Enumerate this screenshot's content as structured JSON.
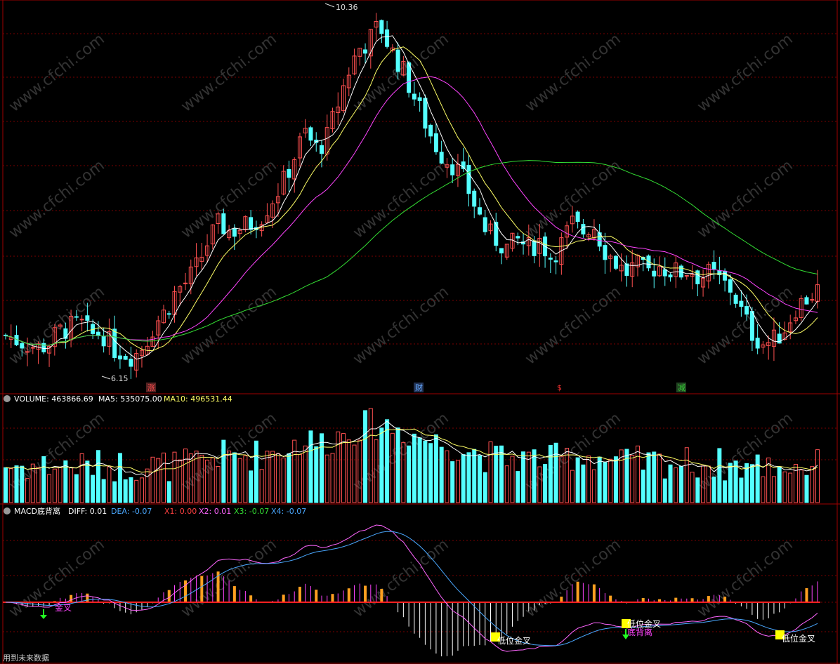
{
  "main_panel": {
    "high_label": "10.36",
    "low_label": "6.15",
    "markers": [
      {
        "text": "涨",
        "color": "#ff4d4d",
        "bg": "#552222"
      },
      {
        "text": "财",
        "color": "#66aaff",
        "bg": "#223355"
      },
      {
        "text": "$",
        "color": "#ff3333",
        "bg": ""
      },
      {
        "text": "减",
        "color": "#33cc33",
        "bg": "#224422"
      }
    ]
  },
  "volume_panel": {
    "title": "VOLUME: 463866.69",
    "ma5": "MA5: 535075.00",
    "ma10": "MA10: 496531.44"
  },
  "macd_panel": {
    "title": "MACD底背离",
    "diff": "DIFF: 0.01",
    "dea": "DEA: -0.07",
    "x1": "X1: 0.00",
    "x2": "X2: 0.01",
    "x3": "X3: -0.07",
    "x4": "X4: -0.07",
    "signals": [
      {
        "text": "金叉"
      },
      {
        "text": "低位金叉"
      },
      {
        "text": "低位金叉"
      },
      {
        "text": "底背离"
      },
      {
        "text": "低位金叉"
      }
    ]
  },
  "footer": {
    "note": "用到未来数据"
  },
  "watermark": "www.cfchi.com",
  "colors": {
    "up": "#ff5050",
    "down": "#54ffff",
    "ma5": "#ffffff",
    "ma10": "#ffff66",
    "ma20": "#ff44ff",
    "ma60": "#33dd33",
    "grid": "#7a0000",
    "macd_pos": "#ffa020",
    "macd_neg": "#ffffff"
  },
  "chart_data": {
    "type": "candlestick",
    "price_range": [
      6.15,
      10.36
    ],
    "close_path": [
      6.45,
      6.4,
      6.35,
      6.3,
      6.35,
      6.5,
      6.55,
      6.6,
      6.45,
      6.5,
      6.3,
      6.25,
      6.2,
      6.35,
      6.6,
      6.75,
      7.0,
      7.1,
      7.3,
      7.6,
      7.8,
      7.7,
      7.75,
      7.8,
      7.9,
      8.1,
      8.3,
      8.6,
      8.9,
      8.7,
      8.8,
      9.2,
      9.6,
      9.9,
      10.0,
      10.2,
      9.9,
      9.7,
      9.4,
      9.1,
      8.8,
      8.6,
      8.5,
      8.3,
      8.0,
      7.7,
      7.6,
      7.5,
      7.6,
      7.5,
      7.6,
      7.4,
      7.55,
      7.8,
      7.7,
      7.8,
      7.5,
      7.35,
      7.2,
      7.3,
      7.2,
      7.3,
      7.25,
      7.2,
      7.25,
      7.15,
      7.2,
      7.1,
      7.0,
      6.7,
      6.45,
      6.35,
      6.4,
      6.55,
      6.8,
      6.9,
      7.0
    ]
  }
}
